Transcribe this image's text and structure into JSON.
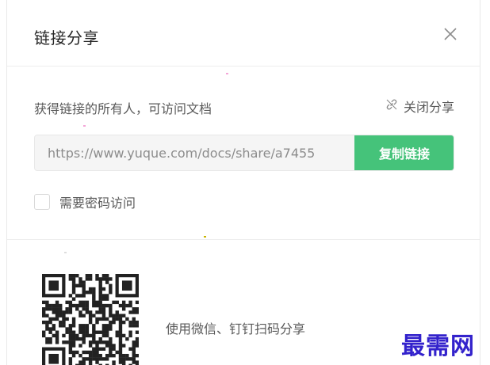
{
  "dialog": {
    "title": "链接分享",
    "close_icon": "close-icon"
  },
  "share": {
    "description": "获得链接的所有人，可访问文档",
    "close_share_label": "关闭分享",
    "close_share_icon": "unlink-icon",
    "link_value": "https://www.yuque.com/docs/share/a7455",
    "copy_button_label": "复制链接",
    "accent_color": "#45c37a"
  },
  "password": {
    "label": "需要密码访问",
    "checked": false
  },
  "qr": {
    "icon": "qr-code-icon",
    "caption": "使用微信、钉钉扫码分享"
  },
  "watermark": {
    "text": "最需网"
  }
}
